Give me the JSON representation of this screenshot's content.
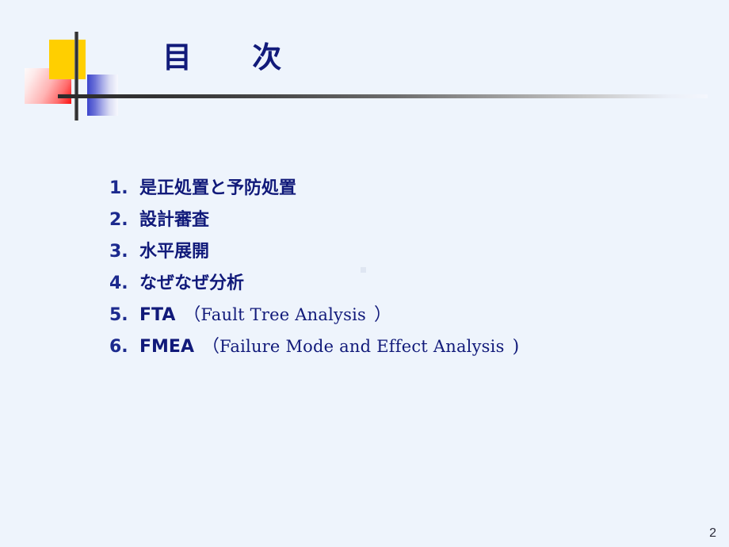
{
  "slide": {
    "title": "目　　次",
    "background_color": "#eef4fc",
    "text_color": "#111a7a",
    "page_number": "2"
  },
  "ornament": {
    "yellow_color": "#ffcf00",
    "red_color": "#fa0f0f",
    "blue_color": "#3b44cc",
    "line_color": "#2b2b2b"
  },
  "toc": {
    "items": [
      {
        "number": "1.",
        "text": "是正処置と予防処置",
        "paren_open": "",
        "english": "",
        "paren_close": ""
      },
      {
        "number": "2.",
        "text": "設計審査",
        "paren_open": "",
        "english": "",
        "paren_close": ""
      },
      {
        "number": "3.",
        "text": "水平展開",
        "paren_open": "",
        "english": "",
        "paren_close": ""
      },
      {
        "number": "4.",
        "text": "なぜなぜ分析",
        "paren_open": "",
        "english": "",
        "paren_close": ""
      },
      {
        "number": "5.",
        "text": "FTA",
        "paren_open": "（",
        "english": "Fault  Tree  Analysis",
        "paren_close": "）"
      },
      {
        "number": "6.",
        "text": "FMEA",
        "paren_open": "（",
        "english": "Failure  Mode  and  Effect  Analysis",
        "paren_close": ")"
      }
    ]
  }
}
